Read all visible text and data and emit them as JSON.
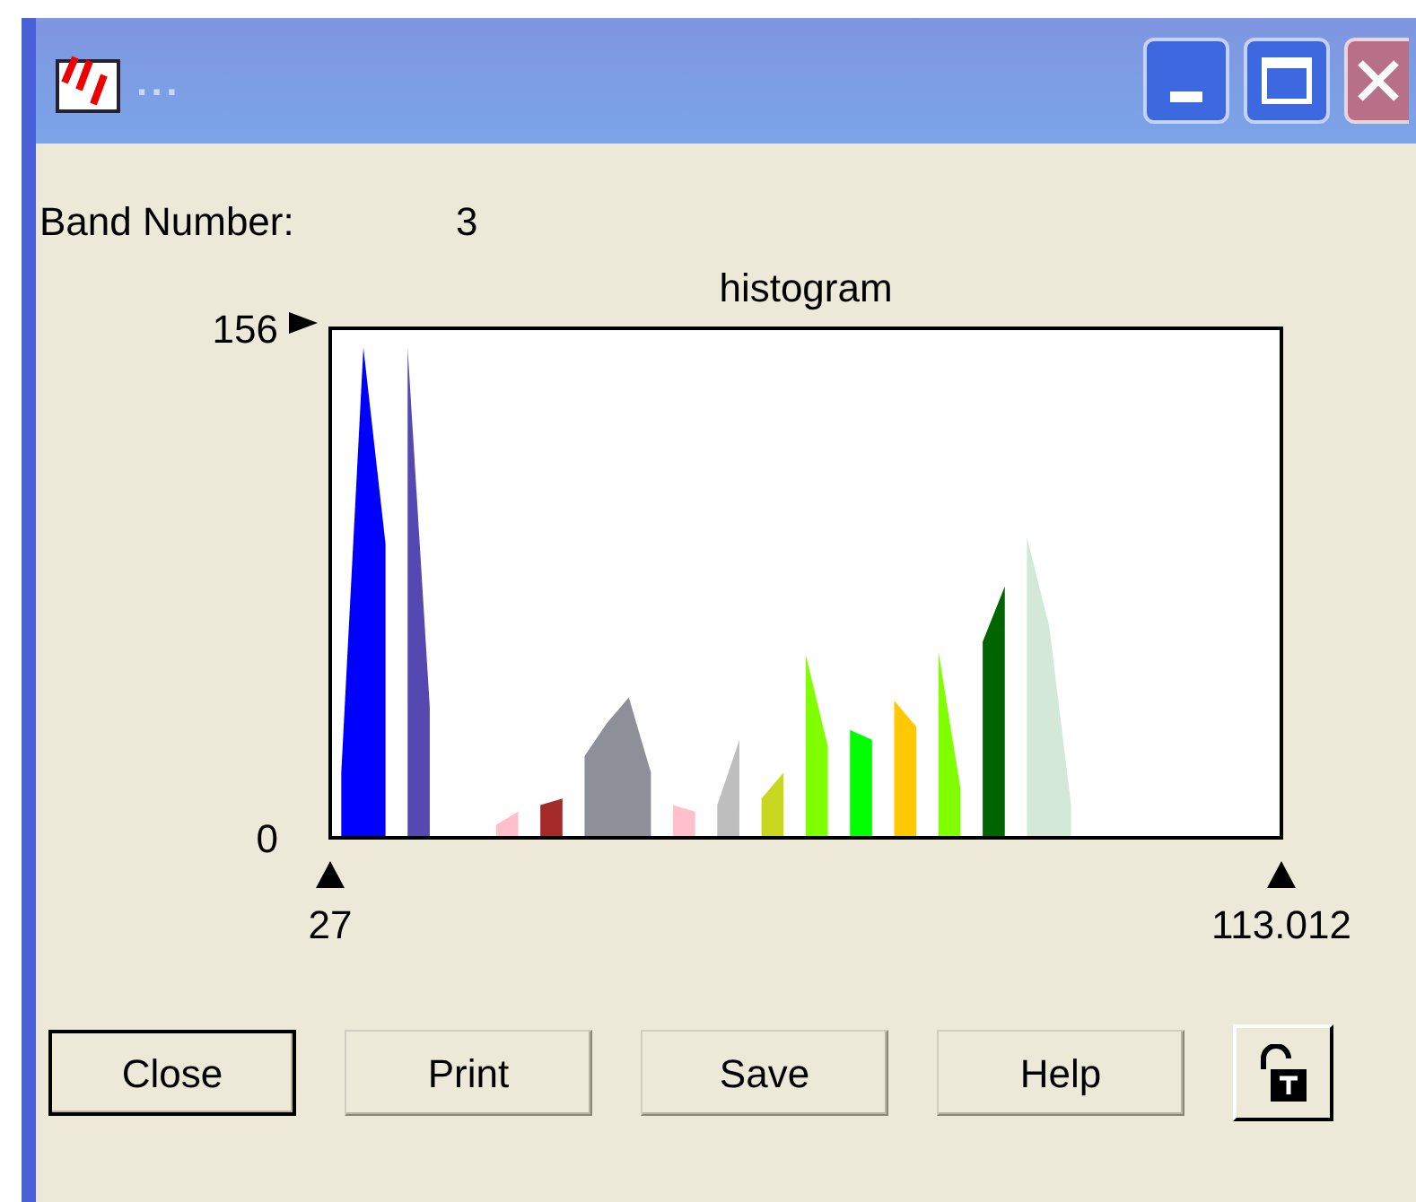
{
  "window": {
    "title": "..."
  },
  "band": {
    "label": "Band Number:",
    "value": "3"
  },
  "histogram": {
    "chart_data": {
      "type": "area",
      "title": "histogram",
      "x": [
        28,
        30,
        32,
        34,
        36,
        38,
        40,
        42,
        44,
        46,
        48,
        50,
        52,
        54,
        56,
        58,
        60,
        62,
        64,
        66,
        68,
        70,
        72,
        74,
        76,
        78,
        80,
        82,
        84,
        86,
        88,
        90,
        92,
        94
      ],
      "xlim": [
        27,
        113.012
      ],
      "ylim": [
        0,
        156
      ],
      "xticks": [
        27,
        113.012
      ],
      "yticks": [
        0,
        156
      ],
      "series": [
        {
          "color": "#ffc0cb",
          "values": [
            null,
            null,
            null,
            null,
            null,
            null,
            null,
            4,
            8,
            null,
            null,
            null,
            null,
            null,
            null,
            10,
            8,
            null,
            null,
            null,
            null,
            null,
            null,
            null,
            null,
            null,
            null,
            null,
            null,
            null,
            null,
            null,
            null,
            null
          ]
        },
        {
          "color": "#a52a2a",
          "values": [
            null,
            null,
            null,
            null,
            null,
            null,
            null,
            null,
            null,
            10,
            12,
            null,
            null,
            null,
            null,
            null,
            null,
            null,
            null,
            null,
            null,
            null,
            null,
            null,
            null,
            null,
            null,
            null,
            null,
            null,
            null,
            null,
            null,
            null
          ]
        },
        {
          "color": "#8e9099",
          "values": [
            null,
            null,
            null,
            null,
            null,
            null,
            null,
            null,
            null,
            null,
            null,
            25,
            35,
            43,
            20,
            null,
            null,
            null,
            null,
            null,
            null,
            null,
            null,
            null,
            null,
            null,
            null,
            null,
            null,
            null,
            null,
            null,
            null,
            null
          ]
        },
        {
          "color": "#bebebe",
          "values": [
            null,
            null,
            null,
            null,
            null,
            null,
            null,
            null,
            null,
            null,
            null,
            null,
            null,
            null,
            null,
            null,
            null,
            10,
            30,
            null,
            null,
            null,
            null,
            null,
            null,
            null,
            null,
            null,
            null,
            null,
            null,
            null,
            null,
            null
          ]
        },
        {
          "color": "#ffc800",
          "values": [
            null,
            null,
            null,
            null,
            null,
            null,
            null,
            null,
            null,
            null,
            null,
            null,
            null,
            null,
            null,
            null,
            null,
            null,
            null,
            null,
            null,
            null,
            null,
            null,
            null,
            42,
            34,
            null,
            null,
            null,
            null,
            null,
            null,
            null
          ]
        },
        {
          "color": "#80ff00",
          "values": [
            null,
            null,
            null,
            null,
            null,
            null,
            null,
            null,
            null,
            null,
            null,
            null,
            null,
            null,
            null,
            null,
            null,
            null,
            null,
            null,
            null,
            56,
            28,
            null,
            null,
            null,
            null,
            57,
            15,
            null,
            null,
            null,
            null,
            null
          ]
        },
        {
          "color": "#c8d820",
          "values": [
            null,
            null,
            null,
            null,
            null,
            null,
            null,
            null,
            null,
            null,
            null,
            null,
            null,
            null,
            null,
            null,
            null,
            null,
            null,
            12,
            20,
            null,
            null,
            null,
            null,
            null,
            null,
            null,
            null,
            null,
            null,
            null,
            null,
            null
          ]
        },
        {
          "color": "#00ff00",
          "values": [
            null,
            null,
            null,
            null,
            null,
            null,
            null,
            null,
            null,
            null,
            null,
            null,
            null,
            null,
            null,
            null,
            null,
            null,
            null,
            null,
            null,
            null,
            null,
            33,
            30,
            null,
            null,
            null,
            null,
            null,
            null,
            null,
            null,
            null
          ]
        },
        {
          "color": "#d4e8d8",
          "values": [
            null,
            null,
            null,
            null,
            null,
            null,
            null,
            null,
            null,
            null,
            null,
            null,
            null,
            null,
            null,
            null,
            null,
            null,
            null,
            null,
            null,
            null,
            null,
            null,
            null,
            null,
            null,
            null,
            null,
            null,
            null,
            92,
            65,
            10
          ]
        },
        {
          "color": "#006400",
          "values": [
            null,
            null,
            null,
            null,
            null,
            null,
            null,
            null,
            null,
            null,
            null,
            null,
            null,
            null,
            null,
            null,
            null,
            null,
            null,
            null,
            null,
            null,
            null,
            null,
            null,
            null,
            null,
            null,
            null,
            60,
            77,
            null,
            null,
            null
          ]
        },
        {
          "color": "#5548b0",
          "values": [
            null,
            null,
            null,
            150,
            40,
            null,
            null,
            null,
            null,
            null,
            null,
            null,
            null,
            null,
            null,
            null,
            null,
            null,
            null,
            null,
            null,
            null,
            null,
            null,
            null,
            null,
            null,
            null,
            null,
            null,
            null,
            null,
            null,
            null
          ]
        },
        {
          "color": "#0000ff",
          "values": [
            20,
            150,
            90,
            null,
            null,
            null,
            null,
            null,
            null,
            null,
            null,
            null,
            null,
            null,
            null,
            null,
            null,
            null,
            null,
            null,
            null,
            null,
            null,
            null,
            null,
            null,
            null,
            null,
            null,
            null,
            null,
            null,
            null,
            null
          ]
        }
      ]
    }
  },
  "buttons": [
    {
      "kind": "text",
      "label": "Close",
      "default": true
    },
    {
      "kind": "text",
      "label": "Print",
      "default": false
    },
    {
      "kind": "text",
      "label": "Save",
      "default": false
    },
    {
      "kind": "text",
      "label": "Help",
      "default": false
    },
    {
      "kind": "lock",
      "default": false
    }
  ]
}
